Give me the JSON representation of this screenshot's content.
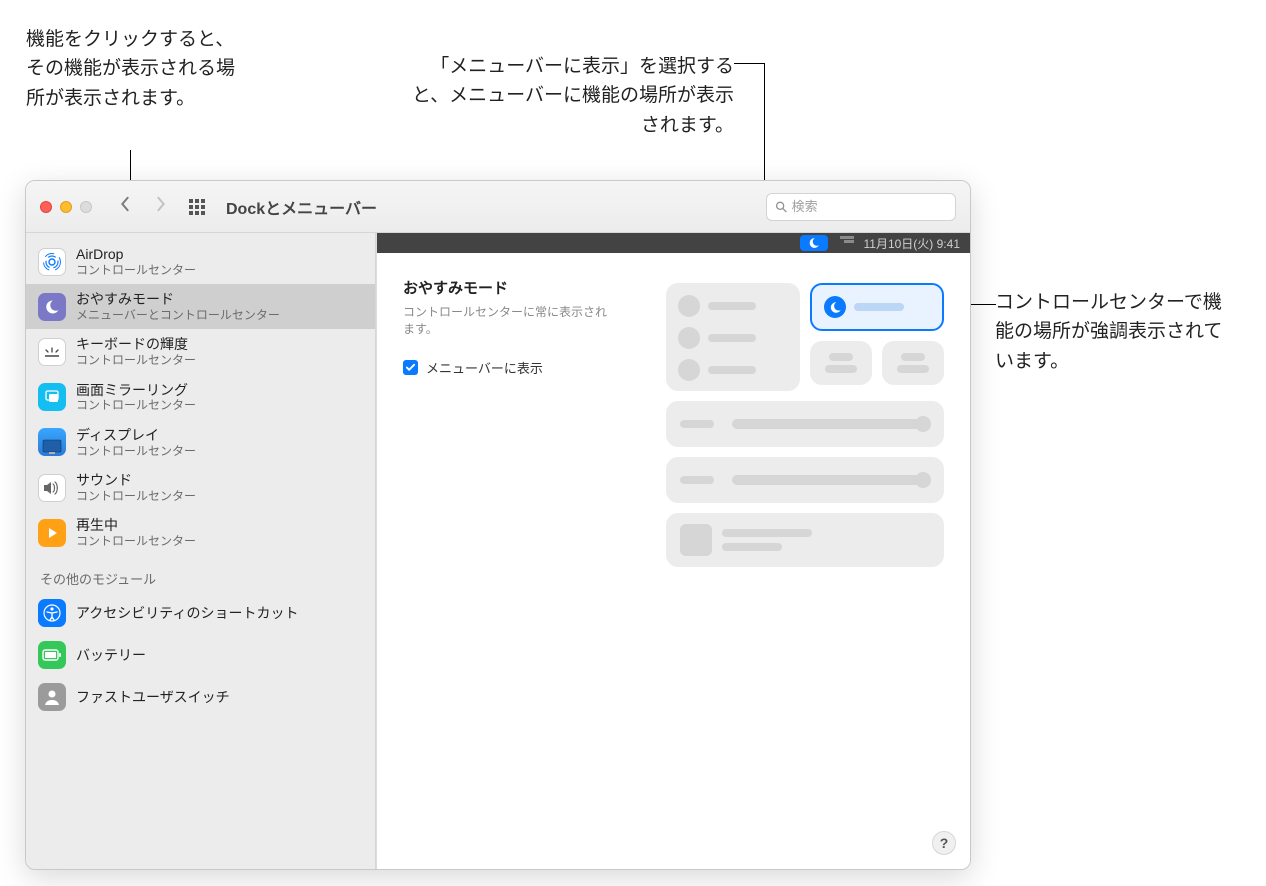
{
  "callouts": {
    "c1": "機能をクリックすると、その機能が表示される場所が表示されます。",
    "c2": "「メニューバーに表示」を選択すると、メニューバーに機能の場所が表示されます。",
    "c3": "コントロールセンターで機能の場所が強調表示されています。"
  },
  "titlebar": {
    "title": "Dockとメニューバー"
  },
  "search": {
    "placeholder": "検索"
  },
  "sidebar": {
    "section_header": "その他のモジュール",
    "items": [
      {
        "label": "AirDrop",
        "sub": "コントロールセンター"
      },
      {
        "label": "おやすみモード",
        "sub": "メニューバーとコントロールセンター"
      },
      {
        "label": "キーボードの輝度",
        "sub": "コントロールセンター"
      },
      {
        "label": "画面ミラーリング",
        "sub": "コントロールセンター"
      },
      {
        "label": "ディスプレイ",
        "sub": "コントロールセンター"
      },
      {
        "label": "サウンド",
        "sub": "コントロールセンター"
      },
      {
        "label": "再生中",
        "sub": "コントロールセンター"
      },
      {
        "label": "アクセシビリティのショートカット"
      },
      {
        "label": "バッテリー"
      },
      {
        "label": "ファストユーザスイッチ"
      }
    ]
  },
  "main": {
    "title": "おやすみモード",
    "desc": "コントロールセンターに常に表示されます。",
    "checkbox_label": "メニューバーに表示",
    "menubar_time": "11月10日(火)  9:41"
  },
  "help": "?"
}
